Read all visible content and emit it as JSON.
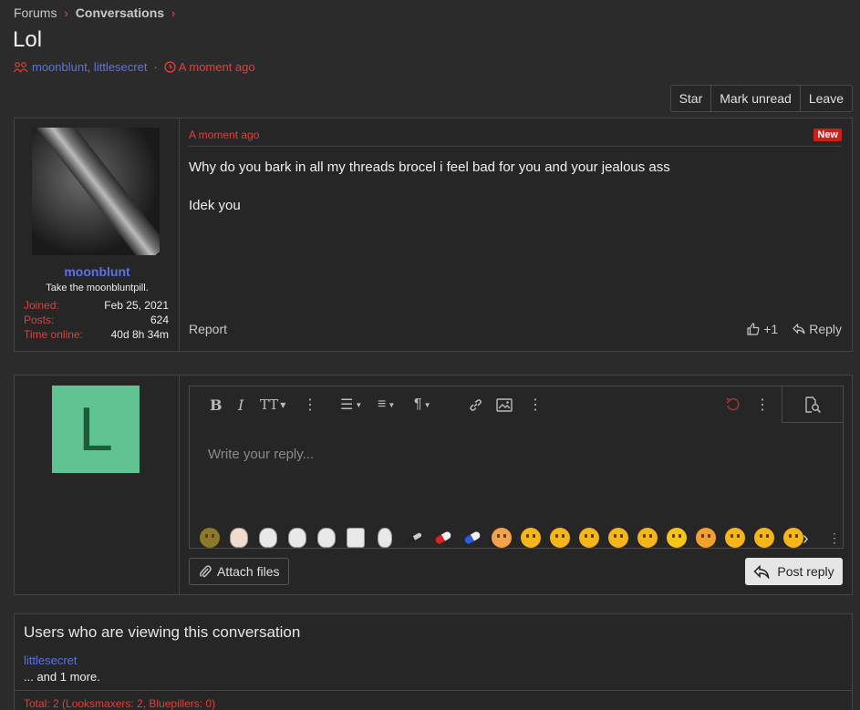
{
  "breadcrumb": {
    "forums": "Forums",
    "conversations": "Conversations"
  },
  "title": "Lol",
  "meta": {
    "participants": "moonblunt, littlesecret",
    "time": "A moment ago"
  },
  "actions": {
    "star": "Star",
    "mark_unread": "Mark unread",
    "leave": "Leave"
  },
  "message": {
    "author": "moonblunt",
    "user_title": "Take the moonbluntpill.",
    "stats": [
      {
        "label": "Joined:",
        "value": "Feb 25, 2021"
      },
      {
        "label": "Posts:",
        "value": "624"
      },
      {
        "label": "Time online:",
        "value": "40d 8h 34m"
      }
    ],
    "timestamp": "A moment ago",
    "badge": "New",
    "line1": "Why do you bark in all my threads brocel i feel bad for you and your jealous ass",
    "line2": "Idek you",
    "report": "Report",
    "likes": "+1",
    "reply": "Reply"
  },
  "reply_box": {
    "avatar_letter": "L",
    "placeholder": "Write your reply...",
    "attach": "Attach files",
    "post": "Post reply"
  },
  "viewers": {
    "heading": "Users who are viewing this conversation",
    "user": "littlesecret",
    "more": "... and 1 more.",
    "total": "Total: 2 (Looksmaxers: 2, Bluepillers: 0)"
  },
  "colors": {
    "accent_red": "#e0403b",
    "username_blue": "#5c73e0",
    "avatar_green": "#5fc491"
  }
}
